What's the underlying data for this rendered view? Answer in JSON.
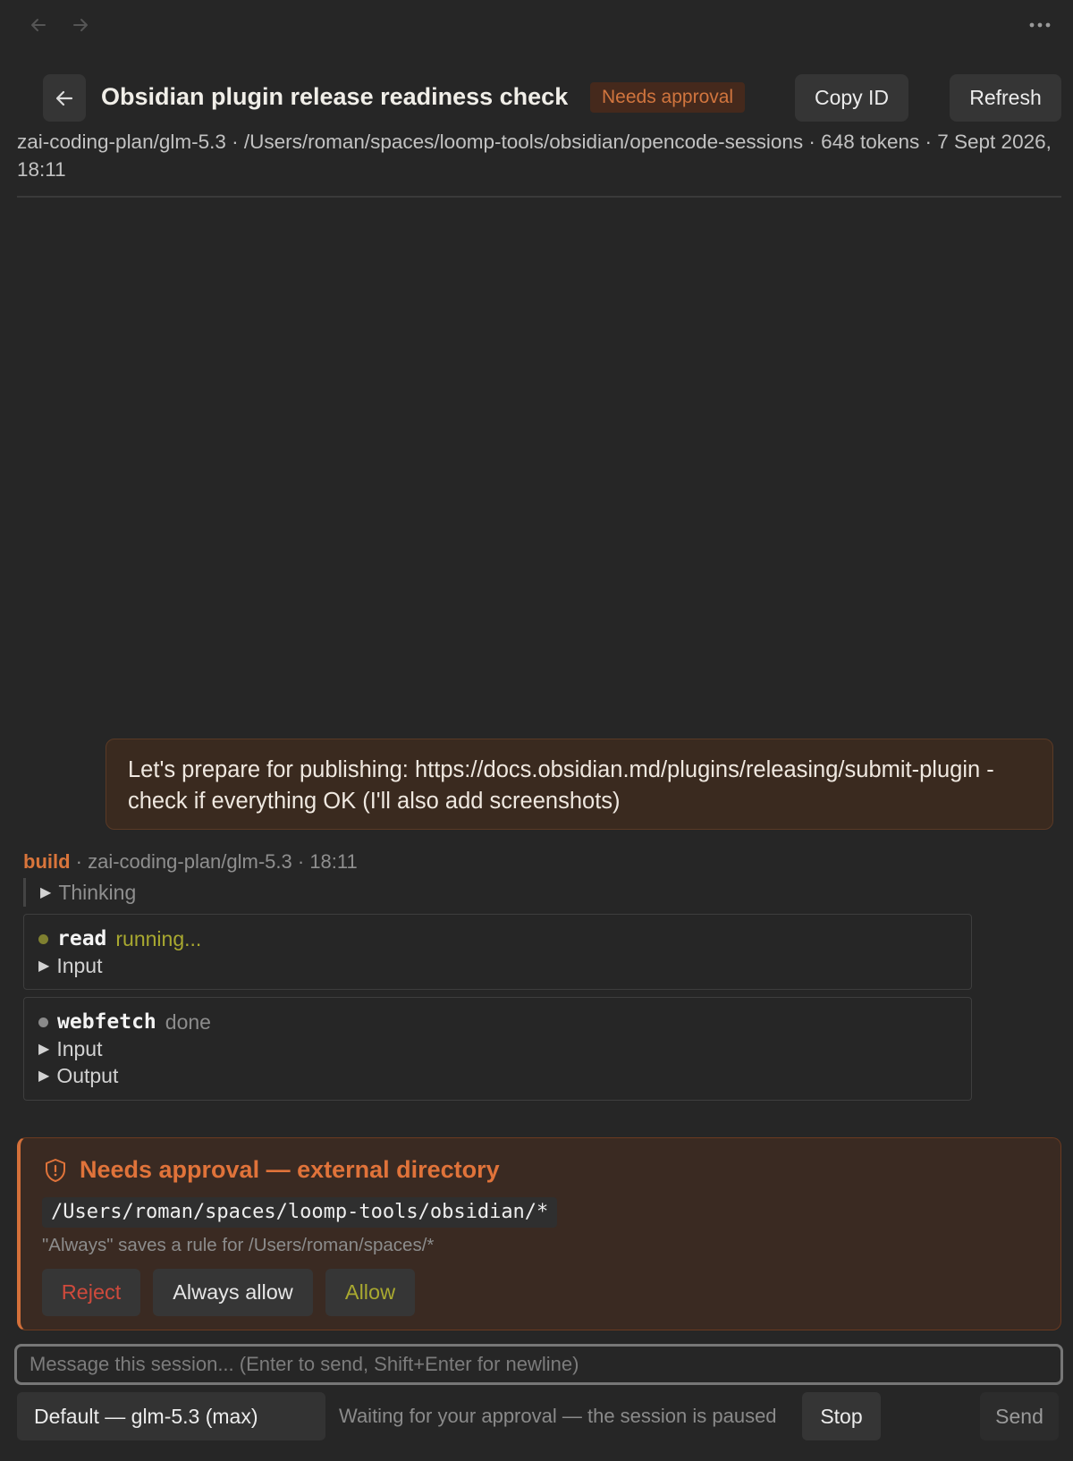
{
  "header": {
    "title": "Obsidian plugin release readiness check",
    "status_badge": "Needs approval",
    "copy_id_label": "Copy ID",
    "refresh_label": "Refresh"
  },
  "meta": {
    "line": "zai-coding-plan/glm-5.3 · /Users/roman/spaces/loomp-tools/obsidian/opencode-sessions · 648 tokens · 7 Sept 2026, 18:11"
  },
  "user_message": {
    "text": "Let's prepare for publishing: https://docs.obsidian.md/plugins/releasing/submit-plugin - check if everything OK (I'll also add screenshots)"
  },
  "agent": {
    "name": "build",
    "details": " · zai-coding-plan/glm-5.3 · 18:11",
    "thinking_label": "Thinking"
  },
  "tools": [
    {
      "name": "read",
      "status": "running...",
      "status_color": "#a9a930",
      "dot_color": "#7f8030",
      "rows": [
        "Input"
      ]
    },
    {
      "name": "webfetch",
      "status": "done",
      "status_color": "#8c8c8c",
      "dot_color": "#8a8a8a",
      "rows": [
        "Input",
        "Output"
      ]
    }
  ],
  "approval": {
    "title": "Needs approval — external directory",
    "path": "/Users/roman/spaces/loomp-tools/obsidian/*",
    "note": "\"Always\" saves a rule for /Users/roman/spaces/*",
    "reject_label": "Reject",
    "always_allow_label": "Always allow",
    "allow_label": "Allow",
    "icon": "shield-icon"
  },
  "composer": {
    "placeholder": "Message this session... (Enter to send, Shift+Enter for newline)",
    "model": "Default — glm-5.3 (max)",
    "waiting_text": "Waiting for your approval — the session is paused",
    "stop_label": "Stop",
    "send_label": "Send"
  },
  "colors": {
    "accent": "#d9753b",
    "background": "#262626"
  }
}
